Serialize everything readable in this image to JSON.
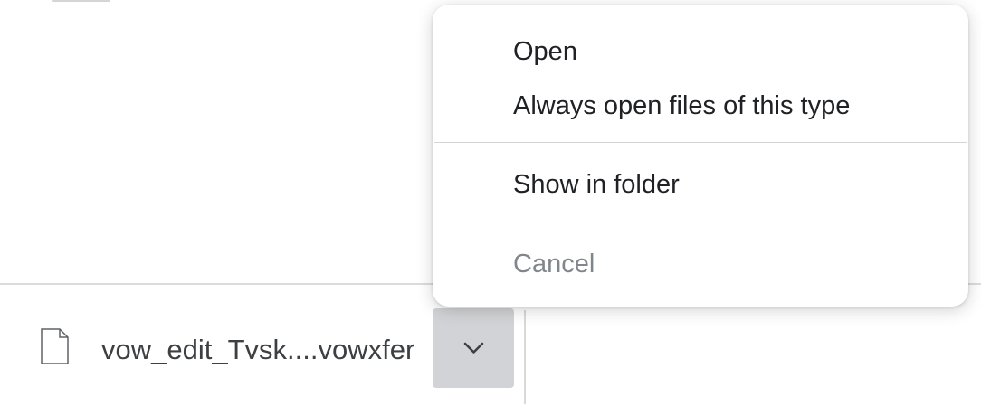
{
  "download": {
    "filename": "vow_edit_Tvsk....vowxfer",
    "file_icon": "document-icon",
    "dropdown_icon": "chevron-down-icon"
  },
  "context_menu": {
    "items": [
      {
        "label": "Open",
        "enabled": true
      },
      {
        "label": "Always open files of this type",
        "enabled": true
      },
      {
        "label": "Show in folder",
        "enabled": true
      },
      {
        "label": "Cancel",
        "enabled": false
      }
    ]
  },
  "colors": {
    "menu_text": "#202124",
    "disabled_text": "#80868b",
    "dropdown_button_bg": "#d2d3d6",
    "separator": "#d4d4d4"
  }
}
